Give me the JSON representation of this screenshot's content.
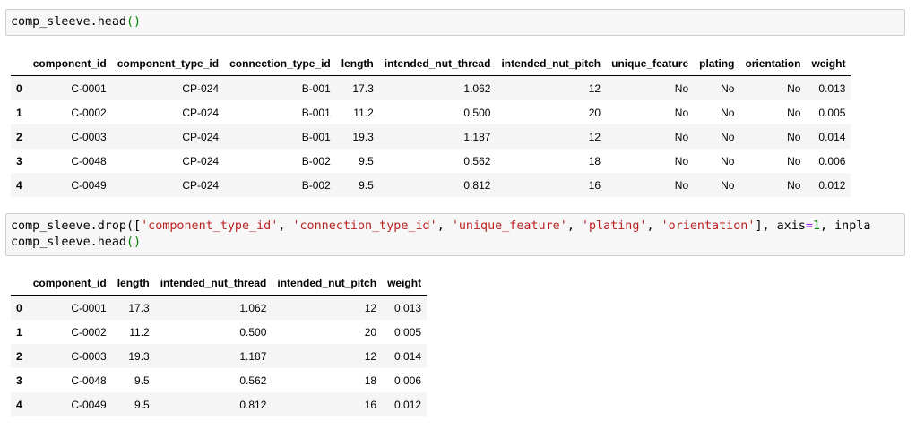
{
  "cell1": {
    "code_obj": "comp_sleeve.head",
    "code_parens": "()"
  },
  "table1": {
    "columns": [
      "",
      "component_id",
      "component_type_id",
      "connection_type_id",
      "length",
      "intended_nut_thread",
      "intended_nut_pitch",
      "unique_feature",
      "plating",
      "orientation",
      "weight"
    ],
    "rows": [
      [
        "0",
        "C-0001",
        "CP-024",
        "B-001",
        "17.3",
        "1.062",
        "12",
        "No",
        "No",
        "No",
        "0.013"
      ],
      [
        "1",
        "C-0002",
        "CP-024",
        "B-001",
        "11.2",
        "0.500",
        "20",
        "No",
        "No",
        "No",
        "0.005"
      ],
      [
        "2",
        "C-0003",
        "CP-024",
        "B-001",
        "19.3",
        "1.187",
        "12",
        "No",
        "No",
        "No",
        "0.014"
      ],
      [
        "3",
        "C-0048",
        "CP-024",
        "B-002",
        "9.5",
        "0.562",
        "18",
        "No",
        "No",
        "No",
        "0.006"
      ],
      [
        "4",
        "C-0049",
        "CP-024",
        "B-002",
        "9.5",
        "0.812",
        "16",
        "No",
        "No",
        "No",
        "0.012"
      ]
    ]
  },
  "cell2": {
    "line1_prefix": "comp_sleeve.drop([",
    "str1": "'component_type_id'",
    "sep1": ", ",
    "str2": "'connection_type_id'",
    "sep2": ", ",
    "str3": "'unique_feature'",
    "sep3": ", ",
    "str4": "'plating'",
    "sep4": ", ",
    "str5": "'orientation'",
    "after_list": "], axis",
    "eq": "=",
    "num": "1",
    "tail": ", inpla",
    "line2_obj": "comp_sleeve.head",
    "line2_parens": "()"
  },
  "table2": {
    "columns": [
      "",
      "component_id",
      "length",
      "intended_nut_thread",
      "intended_nut_pitch",
      "weight"
    ],
    "rows": [
      [
        "0",
        "C-0001",
        "17.3",
        "1.062",
        "12",
        "0.013"
      ],
      [
        "1",
        "C-0002",
        "11.2",
        "0.500",
        "20",
        "0.005"
      ],
      [
        "2",
        "C-0003",
        "19.3",
        "1.187",
        "12",
        "0.014"
      ],
      [
        "3",
        "C-0048",
        "9.5",
        "0.562",
        "18",
        "0.006"
      ],
      [
        "4",
        "C-0049",
        "9.5",
        "0.812",
        "16",
        "0.012"
      ]
    ]
  }
}
